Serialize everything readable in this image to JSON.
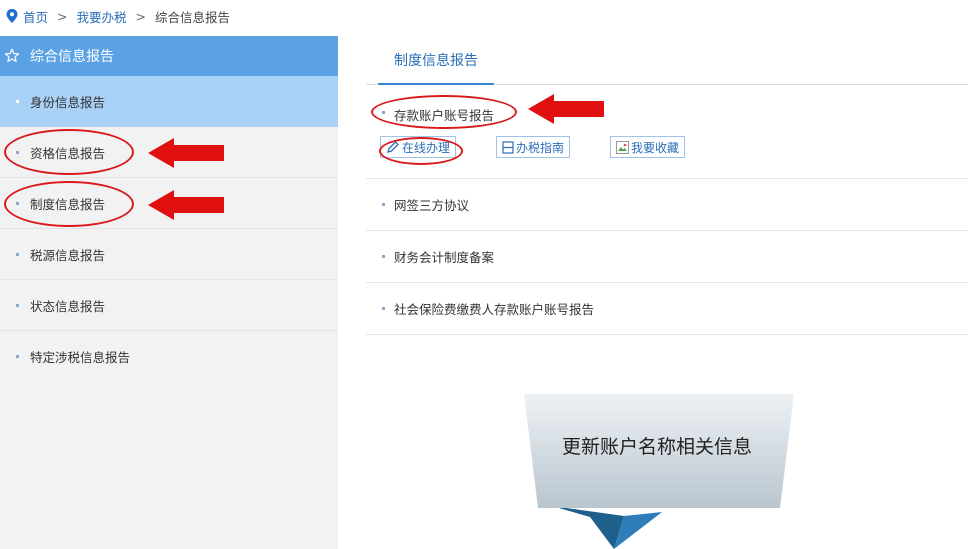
{
  "breadcrumb": {
    "home": "首页",
    "separator": ">",
    "level2": "我要办税",
    "current": "综合信息报告"
  },
  "sidebar": {
    "header": "综合信息报告",
    "items": [
      {
        "label": "身份信息报告",
        "active": true
      },
      {
        "label": "资格信息报告",
        "active": false
      },
      {
        "label": "制度信息报告",
        "active": false
      },
      {
        "label": "税源信息报告",
        "active": false
      },
      {
        "label": "状态信息报告",
        "active": false
      },
      {
        "label": "特定涉税信息报告",
        "active": false
      }
    ]
  },
  "main": {
    "tab": "制度信息报告",
    "rows": [
      {
        "label": "存款账户账号报告",
        "actions": [
          "在线办理",
          "办税指南",
          "我要收藏"
        ]
      },
      {
        "label": "网签三方协议"
      },
      {
        "label": "财务会计制度备案"
      },
      {
        "label": "社会保险费缴费人存款账户账号报告"
      }
    ]
  },
  "callout": {
    "text": "更新账户名称相关信息"
  },
  "colors": {
    "accent": "#5aa2e4",
    "active_item": "#a8d1f5",
    "link": "#2a6fb8",
    "annotation": "#d91a1a"
  },
  "icons": [
    "location-pin-icon",
    "star-outline-icon",
    "pencil-icon",
    "guide-icon",
    "broken-image-icon",
    "red-arrow-icon"
  ]
}
